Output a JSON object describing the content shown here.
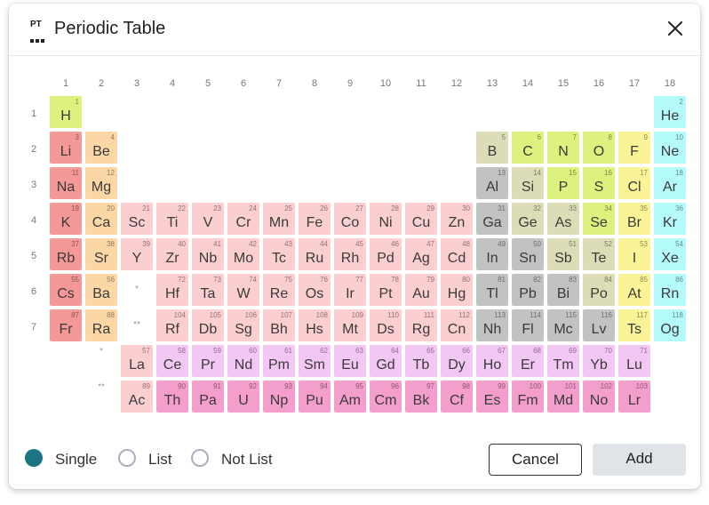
{
  "title": "Periodic Table",
  "logo_text": "PT",
  "icons": {
    "logo": "periodic-table-logo-icon",
    "close": "close-icon"
  },
  "group_numbers": [
    "1",
    "2",
    "3",
    "4",
    "5",
    "6",
    "7",
    "8",
    "9",
    "10",
    "11",
    "12",
    "13",
    "14",
    "15",
    "16",
    "17",
    "18"
  ],
  "period_numbers": [
    "1",
    "2",
    "3",
    "4",
    "5",
    "6",
    "7"
  ],
  "series_markers": {
    "lanthanide": "*",
    "actinide": "**"
  },
  "category_colors": {
    "hydrogen": "#ddf17f",
    "alkali": "#f49898",
    "alkaline": "#fbd7a6",
    "transition": "#fbcfcf",
    "post-transition": "#c2c2c2",
    "metalloid": "#dcdcb6",
    "nonmetal": "#ddf17f",
    "halogen": "#faf497",
    "noble": "#b5fafa",
    "lanthanide": "#f2c7f3",
    "actinide": "#f49ecb"
  },
  "elements": [
    {
      "n": 1,
      "s": "H",
      "c": "hydrogen",
      "g": 1,
      "p": 1
    },
    {
      "n": 2,
      "s": "He",
      "c": "noble",
      "g": 18,
      "p": 1
    },
    {
      "n": 3,
      "s": "Li",
      "c": "alkali",
      "g": 1,
      "p": 2
    },
    {
      "n": 4,
      "s": "Be",
      "c": "alkaline",
      "g": 2,
      "p": 2
    },
    {
      "n": 5,
      "s": "B",
      "c": "metalloid",
      "g": 13,
      "p": 2
    },
    {
      "n": 6,
      "s": "C",
      "c": "nonmetal",
      "g": 14,
      "p": 2
    },
    {
      "n": 7,
      "s": "N",
      "c": "nonmetal",
      "g": 15,
      "p": 2
    },
    {
      "n": 8,
      "s": "O",
      "c": "nonmetal",
      "g": 16,
      "p": 2
    },
    {
      "n": 9,
      "s": "F",
      "c": "halogen",
      "g": 17,
      "p": 2
    },
    {
      "n": 10,
      "s": "Ne",
      "c": "noble",
      "g": 18,
      "p": 2
    },
    {
      "n": 11,
      "s": "Na",
      "c": "alkali",
      "g": 1,
      "p": 3
    },
    {
      "n": 12,
      "s": "Mg",
      "c": "alkaline",
      "g": 2,
      "p": 3
    },
    {
      "n": 13,
      "s": "Al",
      "c": "post-transition",
      "g": 13,
      "p": 3
    },
    {
      "n": 14,
      "s": "Si",
      "c": "metalloid",
      "g": 14,
      "p": 3
    },
    {
      "n": 15,
      "s": "P",
      "c": "nonmetal",
      "g": 15,
      "p": 3
    },
    {
      "n": 16,
      "s": "S",
      "c": "nonmetal",
      "g": 16,
      "p": 3
    },
    {
      "n": 17,
      "s": "Cl",
      "c": "halogen",
      "g": 17,
      "p": 3
    },
    {
      "n": 18,
      "s": "Ar",
      "c": "noble",
      "g": 18,
      "p": 3
    },
    {
      "n": 19,
      "s": "K",
      "c": "alkali",
      "g": 1,
      "p": 4
    },
    {
      "n": 20,
      "s": "Ca",
      "c": "alkaline",
      "g": 2,
      "p": 4
    },
    {
      "n": 21,
      "s": "Sc",
      "c": "transition",
      "g": 3,
      "p": 4
    },
    {
      "n": 22,
      "s": "Ti",
      "c": "transition",
      "g": 4,
      "p": 4
    },
    {
      "n": 23,
      "s": "V",
      "c": "transition",
      "g": 5,
      "p": 4
    },
    {
      "n": 24,
      "s": "Cr",
      "c": "transition",
      "g": 6,
      "p": 4
    },
    {
      "n": 25,
      "s": "Mn",
      "c": "transition",
      "g": 7,
      "p": 4
    },
    {
      "n": 26,
      "s": "Fe",
      "c": "transition",
      "g": 8,
      "p": 4
    },
    {
      "n": 27,
      "s": "Co",
      "c": "transition",
      "g": 9,
      "p": 4
    },
    {
      "n": 28,
      "s": "Ni",
      "c": "transition",
      "g": 10,
      "p": 4
    },
    {
      "n": 29,
      "s": "Cu",
      "c": "transition",
      "g": 11,
      "p": 4
    },
    {
      "n": 30,
      "s": "Zn",
      "c": "transition",
      "g": 12,
      "p": 4
    },
    {
      "n": 31,
      "s": "Ga",
      "c": "post-transition",
      "g": 13,
      "p": 4
    },
    {
      "n": 32,
      "s": "Ge",
      "c": "metalloid",
      "g": 14,
      "p": 4
    },
    {
      "n": 33,
      "s": "As",
      "c": "metalloid",
      "g": 15,
      "p": 4
    },
    {
      "n": 34,
      "s": "Se",
      "c": "nonmetal",
      "g": 16,
      "p": 4
    },
    {
      "n": 35,
      "s": "Br",
      "c": "halogen",
      "g": 17,
      "p": 4
    },
    {
      "n": 36,
      "s": "Kr",
      "c": "noble",
      "g": 18,
      "p": 4
    },
    {
      "n": 37,
      "s": "Rb",
      "c": "alkali",
      "g": 1,
      "p": 5
    },
    {
      "n": 38,
      "s": "Sr",
      "c": "alkaline",
      "g": 2,
      "p": 5
    },
    {
      "n": 39,
      "s": "Y",
      "c": "transition",
      "g": 3,
      "p": 5
    },
    {
      "n": 40,
      "s": "Zr",
      "c": "transition",
      "g": 4,
      "p": 5
    },
    {
      "n": 41,
      "s": "Nb",
      "c": "transition",
      "g": 5,
      "p": 5
    },
    {
      "n": 42,
      "s": "Mo",
      "c": "transition",
      "g": 6,
      "p": 5
    },
    {
      "n": 43,
      "s": "Tc",
      "c": "transition",
      "g": 7,
      "p": 5
    },
    {
      "n": 44,
      "s": "Ru",
      "c": "transition",
      "g": 8,
      "p": 5
    },
    {
      "n": 45,
      "s": "Rh",
      "c": "transition",
      "g": 9,
      "p": 5
    },
    {
      "n": 46,
      "s": "Pd",
      "c": "transition",
      "g": 10,
      "p": 5
    },
    {
      "n": 47,
      "s": "Ag",
      "c": "transition",
      "g": 11,
      "p": 5
    },
    {
      "n": 48,
      "s": "Cd",
      "c": "transition",
      "g": 12,
      "p": 5
    },
    {
      "n": 49,
      "s": "In",
      "c": "post-transition",
      "g": 13,
      "p": 5
    },
    {
      "n": 50,
      "s": "Sn",
      "c": "post-transition",
      "g": 14,
      "p": 5
    },
    {
      "n": 51,
      "s": "Sb",
      "c": "metalloid",
      "g": 15,
      "p": 5
    },
    {
      "n": 52,
      "s": "Te",
      "c": "metalloid",
      "g": 16,
      "p": 5
    },
    {
      "n": 53,
      "s": "I",
      "c": "halogen",
      "g": 17,
      "p": 5
    },
    {
      "n": 54,
      "s": "Xe",
      "c": "noble",
      "g": 18,
      "p": 5
    },
    {
      "n": 55,
      "s": "Cs",
      "c": "alkali",
      "g": 1,
      "p": 6
    },
    {
      "n": 56,
      "s": "Ba",
      "c": "alkaline",
      "g": 2,
      "p": 6
    },
    {
      "n": 72,
      "s": "Hf",
      "c": "transition",
      "g": 4,
      "p": 6
    },
    {
      "n": 73,
      "s": "Ta",
      "c": "transition",
      "g": 5,
      "p": 6
    },
    {
      "n": 74,
      "s": "W",
      "c": "transition",
      "g": 6,
      "p": 6
    },
    {
      "n": 75,
      "s": "Re",
      "c": "transition",
      "g": 7,
      "p": 6
    },
    {
      "n": 76,
      "s": "Os",
      "c": "transition",
      "g": 8,
      "p": 6
    },
    {
      "n": 77,
      "s": "Ir",
      "c": "transition",
      "g": 9,
      "p": 6
    },
    {
      "n": 78,
      "s": "Pt",
      "c": "transition",
      "g": 10,
      "p": 6
    },
    {
      "n": 79,
      "s": "Au",
      "c": "transition",
      "g": 11,
      "p": 6
    },
    {
      "n": 80,
      "s": "Hg",
      "c": "transition",
      "g": 12,
      "p": 6
    },
    {
      "n": 81,
      "s": "Tl",
      "c": "post-transition",
      "g": 13,
      "p": 6
    },
    {
      "n": 82,
      "s": "Pb",
      "c": "post-transition",
      "g": 14,
      "p": 6
    },
    {
      "n": 83,
      "s": "Bi",
      "c": "post-transition",
      "g": 15,
      "p": 6
    },
    {
      "n": 84,
      "s": "Po",
      "c": "metalloid",
      "g": 16,
      "p": 6
    },
    {
      "n": 85,
      "s": "At",
      "c": "halogen",
      "g": 17,
      "p": 6
    },
    {
      "n": 86,
      "s": "Rn",
      "c": "noble",
      "g": 18,
      "p": 6
    },
    {
      "n": 87,
      "s": "Fr",
      "c": "alkali",
      "g": 1,
      "p": 7
    },
    {
      "n": 88,
      "s": "Ra",
      "c": "alkaline",
      "g": 2,
      "p": 7
    },
    {
      "n": 104,
      "s": "Rf",
      "c": "transition",
      "g": 4,
      "p": 7
    },
    {
      "n": 105,
      "s": "Db",
      "c": "transition",
      "g": 5,
      "p": 7
    },
    {
      "n": 106,
      "s": "Sg",
      "c": "transition",
      "g": 6,
      "p": 7
    },
    {
      "n": 107,
      "s": "Bh",
      "c": "transition",
      "g": 7,
      "p": 7
    },
    {
      "n": 108,
      "s": "Hs",
      "c": "transition",
      "g": 8,
      "p": 7
    },
    {
      "n": 109,
      "s": "Mt",
      "c": "transition",
      "g": 9,
      "p": 7
    },
    {
      "n": 110,
      "s": "Ds",
      "c": "transition",
      "g": 10,
      "p": 7
    },
    {
      "n": 111,
      "s": "Rg",
      "c": "transition",
      "g": 11,
      "p": 7
    },
    {
      "n": 112,
      "s": "Cn",
      "c": "transition",
      "g": 12,
      "p": 7
    },
    {
      "n": 113,
      "s": "Nh",
      "c": "post-transition",
      "g": 13,
      "p": 7
    },
    {
      "n": 114,
      "s": "Fl",
      "c": "post-transition",
      "g": 14,
      "p": 7
    },
    {
      "n": 115,
      "s": "Mc",
      "c": "post-transition",
      "g": 15,
      "p": 7
    },
    {
      "n": 116,
      "s": "Lv",
      "c": "post-transition",
      "g": 16,
      "p": 7
    },
    {
      "n": 117,
      "s": "Ts",
      "c": "halogen",
      "g": 17,
      "p": 7
    },
    {
      "n": 118,
      "s": "Og",
      "c": "noble",
      "g": 18,
      "p": 7
    },
    {
      "n": 57,
      "s": "La",
      "c": "transition",
      "g": 3,
      "p": 8
    },
    {
      "n": 58,
      "s": "Ce",
      "c": "lanthanide",
      "g": 4,
      "p": 8
    },
    {
      "n": 59,
      "s": "Pr",
      "c": "lanthanide",
      "g": 5,
      "p": 8
    },
    {
      "n": 60,
      "s": "Nd",
      "c": "lanthanide",
      "g": 6,
      "p": 8
    },
    {
      "n": 61,
      "s": "Pm",
      "c": "lanthanide",
      "g": 7,
      "p": 8
    },
    {
      "n": 62,
      "s": "Sm",
      "c": "lanthanide",
      "g": 8,
      "p": 8
    },
    {
      "n": 63,
      "s": "Eu",
      "c": "lanthanide",
      "g": 9,
      "p": 8
    },
    {
      "n": 64,
      "s": "Gd",
      "c": "lanthanide",
      "g": 10,
      "p": 8
    },
    {
      "n": 65,
      "s": "Tb",
      "c": "lanthanide",
      "g": 11,
      "p": 8
    },
    {
      "n": 66,
      "s": "Dy",
      "c": "lanthanide",
      "g": 12,
      "p": 8
    },
    {
      "n": 67,
      "s": "Ho",
      "c": "lanthanide",
      "g": 13,
      "p": 8
    },
    {
      "n": 68,
      "s": "Er",
      "c": "lanthanide",
      "g": 14,
      "p": 8
    },
    {
      "n": 69,
      "s": "Tm",
      "c": "lanthanide",
      "g": 15,
      "p": 8
    },
    {
      "n": 70,
      "s": "Yb",
      "c": "lanthanide",
      "g": 16,
      "p": 8
    },
    {
      "n": 71,
      "s": "Lu",
      "c": "lanthanide",
      "g": 17,
      "p": 8
    },
    {
      "n": 89,
      "s": "Ac",
      "c": "transition",
      "g": 3,
      "p": 9
    },
    {
      "n": 90,
      "s": "Th",
      "c": "actinide",
      "g": 4,
      "p": 9
    },
    {
      "n": 91,
      "s": "Pa",
      "c": "actinide",
      "g": 5,
      "p": 9
    },
    {
      "n": 92,
      "s": "U",
      "c": "actinide",
      "g": 6,
      "p": 9
    },
    {
      "n": 93,
      "s": "Np",
      "c": "actinide",
      "g": 7,
      "p": 9
    },
    {
      "n": 94,
      "s": "Pu",
      "c": "actinide",
      "g": 8,
      "p": 9
    },
    {
      "n": 95,
      "s": "Am",
      "c": "actinide",
      "g": 9,
      "p": 9
    },
    {
      "n": 96,
      "s": "Cm",
      "c": "actinide",
      "g": 10,
      "p": 9
    },
    {
      "n": 97,
      "s": "Bk",
      "c": "actinide",
      "g": 11,
      "p": 9
    },
    {
      "n": 98,
      "s": "Cf",
      "c": "actinide",
      "g": 12,
      "p": 9
    },
    {
      "n": 99,
      "s": "Es",
      "c": "actinide",
      "g": 13,
      "p": 9
    },
    {
      "n": 100,
      "s": "Fm",
      "c": "actinide",
      "g": 14,
      "p": 9
    },
    {
      "n": 101,
      "s": "Md",
      "c": "actinide",
      "g": 15,
      "p": 9
    },
    {
      "n": 102,
      "s": "No",
      "c": "actinide",
      "g": 16,
      "p": 9
    },
    {
      "n": 103,
      "s": "Lr",
      "c": "actinide",
      "g": 17,
      "p": 9
    }
  ],
  "selection_modes": [
    {
      "label": "Single",
      "selected": true
    },
    {
      "label": "List",
      "selected": false
    },
    {
      "label": "Not List",
      "selected": false
    }
  ],
  "accent_color": "#1b7582",
  "buttons": {
    "cancel": "Cancel",
    "add": "Add"
  }
}
